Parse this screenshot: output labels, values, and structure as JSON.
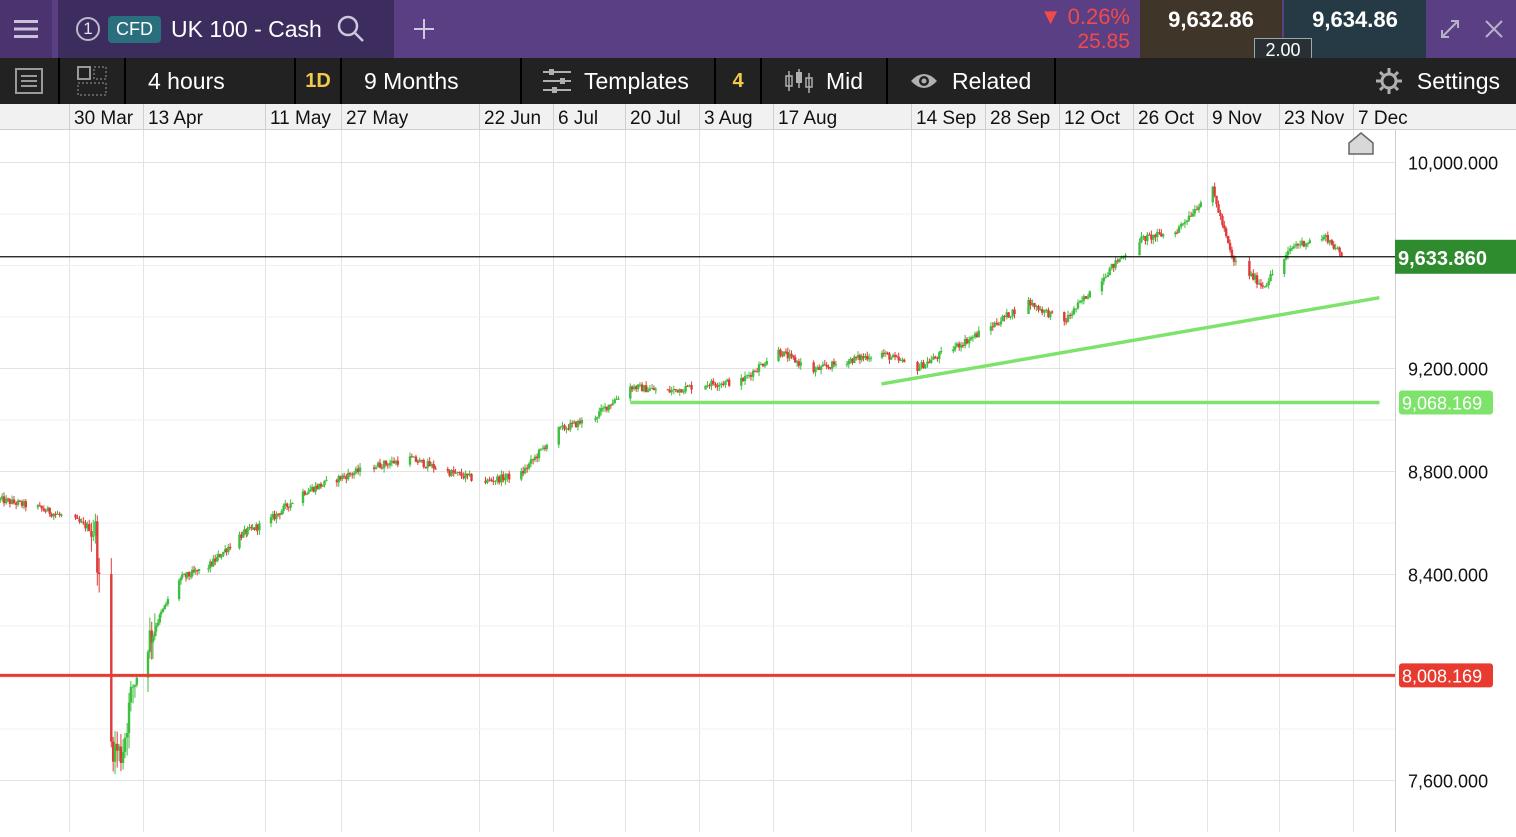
{
  "header": {
    "instrument_index": "1",
    "badge": "CFD",
    "instrument": "UK 100 - Cash",
    "change_pct": "0.26%",
    "change_abs": "25.85",
    "sell_price": "9,632.86",
    "buy_price": "9,634.86",
    "spread": "2.00",
    "add_tab_icon": "plus-icon"
  },
  "toolbar": {
    "interval": "4 hours",
    "period_code": "1D",
    "range": "9 Months",
    "templates": "Templates",
    "indicator_count": "4",
    "price_type": "Mid",
    "related": "Related",
    "settings": "Settings"
  },
  "colors": {
    "title_bg": "#5a3f85",
    "up_candle": "#3fbf3f",
    "down_candle": "#e03a3a",
    "support_line": "#7de36a",
    "resistance_red": "#e83a2f",
    "current_price_bg": "#2e8b2e"
  },
  "chart_data": {
    "type": "candlestick",
    "x_ticks": [
      "30 Mar",
      "13 Apr",
      "11 May",
      "27 May",
      "22 Jun",
      "6 Jul",
      "20 Jul",
      "3 Aug",
      "17 Aug",
      "14 Sep",
      "28 Sep",
      "12 Oct",
      "26 Oct",
      "9 Nov",
      "23 Nov",
      "7 Dec"
    ],
    "y_ticks": [
      {
        "label": "10,000.000",
        "value": 10000
      },
      {
        "label": "9,200.000",
        "value": 9200
      },
      {
        "label": "8,800.000",
        "value": 8800
      },
      {
        "label": "8,400.000",
        "value": 8400
      },
      {
        "label": "7,600.000",
        "value": 7600
      }
    ],
    "ylim": [
      7400,
      10150
    ],
    "close_series": [
      [
        "2025-03-17",
        8690
      ],
      [
        "2025-03-24",
        8660
      ],
      [
        "2025-03-31",
        8610
      ],
      [
        "2025-04-04",
        8570
      ],
      [
        "2025-04-07",
        7740
      ],
      [
        "2025-04-09",
        7700
      ],
      [
        "2025-04-11",
        7960
      ],
      [
        "2025-04-14",
        8140
      ],
      [
        "2025-04-21",
        8380
      ],
      [
        "2025-04-28",
        8430
      ],
      [
        "2025-05-05",
        8550
      ],
      [
        "2025-05-12",
        8610
      ],
      [
        "2025-05-19",
        8720
      ],
      [
        "2025-05-26",
        8770
      ],
      [
        "2025-06-02",
        8820
      ],
      [
        "2025-06-09",
        8850
      ],
      [
        "2025-06-16",
        8800
      ],
      [
        "2025-06-23",
        8760
      ],
      [
        "2025-06-30",
        8790
      ],
      [
        "2025-07-07",
        8960
      ],
      [
        "2025-07-14",
        9010
      ],
      [
        "2025-07-21",
        9130
      ],
      [
        "2025-07-28",
        9110
      ],
      [
        "2025-08-04",
        9140
      ],
      [
        "2025-08-11",
        9150
      ],
      [
        "2025-08-18",
        9270
      ],
      [
        "2025-08-25",
        9190
      ],
      [
        "2025-09-01",
        9230
      ],
      [
        "2025-09-08",
        9260
      ],
      [
        "2025-09-15",
        9200
      ],
      [
        "2025-09-22",
        9280
      ],
      [
        "2025-09-29",
        9360
      ],
      [
        "2025-10-06",
        9460
      ],
      [
        "2025-10-13",
        9380
      ],
      [
        "2025-10-20",
        9550
      ],
      [
        "2025-10-27",
        9700
      ],
      [
        "2025-11-03",
        9730
      ],
      [
        "2025-11-10",
        9900
      ],
      [
        "2025-11-14",
        9620
      ],
      [
        "2025-11-20",
        9520
      ],
      [
        "2025-11-26",
        9680
      ],
      [
        "2025-12-02",
        9710
      ],
      [
        "2025-12-05",
        9634
      ]
    ],
    "current_price": {
      "label": "9,633.860",
      "value": 9633.86
    },
    "horizontal_levels": [
      {
        "label": "9,068.169",
        "value": 9068.169,
        "color": "#7de36a"
      },
      {
        "label": "8,008.169",
        "value": 8008.169,
        "color": "#e83a2f"
      }
    ],
    "trendlines": [
      {
        "from": [
          "2025-09-08",
          9140
        ],
        "to": [
          "2025-12-12",
          9475
        ]
      },
      {
        "from": [
          "2025-07-21",
          9068.169
        ],
        "to": [
          "2025-12-12",
          9068.169
        ]
      }
    ],
    "home_marker_icon": "home-icon"
  }
}
